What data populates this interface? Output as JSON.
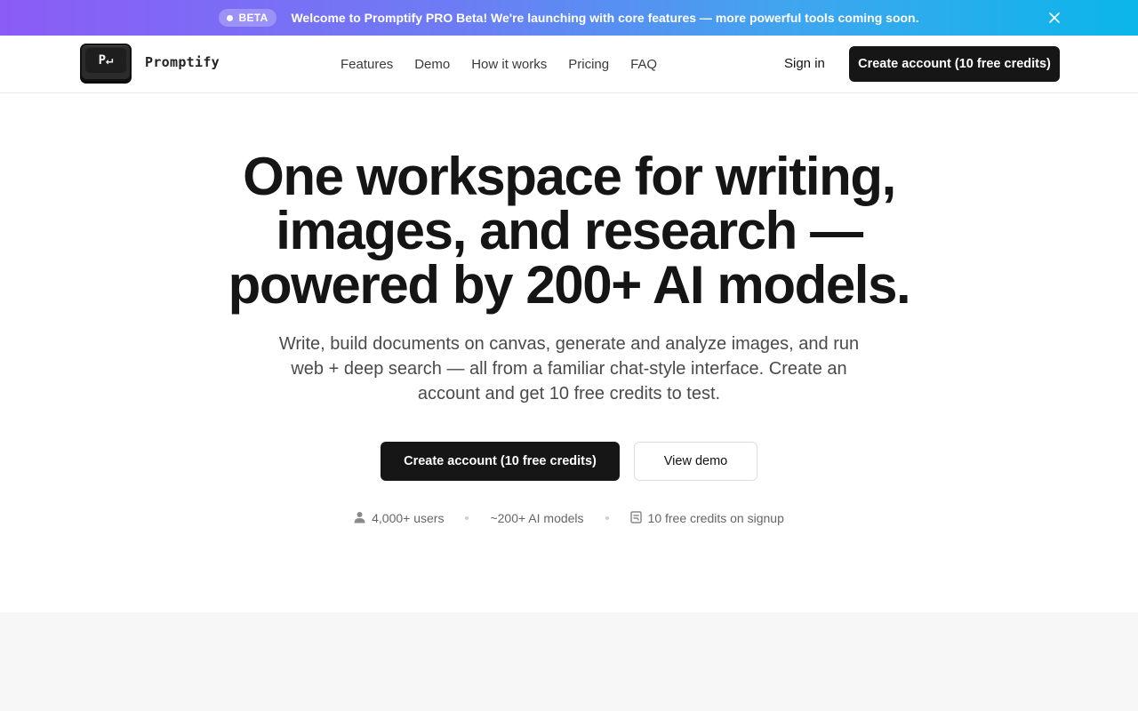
{
  "banner": {
    "badge": "BETA",
    "message": "Welcome to Promptify PRO Beta! We're launching with core features — more powerful tools coming soon.",
    "close_icon": "close-icon",
    "gradient_colors": [
      "#8b5cf6",
      "#0ab6ea"
    ]
  },
  "header": {
    "logo_key": "P↵",
    "brand_name": "Promptify",
    "nav": [
      {
        "label": "Features"
      },
      {
        "label": "Demo"
      },
      {
        "label": "How it works"
      },
      {
        "label": "Pricing"
      },
      {
        "label": "FAQ"
      }
    ],
    "signin_label": "Sign in",
    "cta_label": "Create account (10 free credits)"
  },
  "hero": {
    "title_line1": "One workspace for writing,",
    "title_line2": "images, and research —",
    "title_line3": "powered by 200+ AI models.",
    "subtitle": "Write, build documents on canvas, generate and analyze images, and run web + deep search — all from a familiar chat-style interface. Create an account and get 10 free credits to test.",
    "primary_cta": "Create account (10 free credits)",
    "secondary_cta": "View demo"
  },
  "stats": [
    {
      "icon": "user-icon",
      "label": "4,000+ users"
    },
    {
      "icon": "",
      "label": "~200+ AI models"
    },
    {
      "icon": "credit-badge-icon",
      "label": "10 free credits on signup"
    }
  ],
  "colors": {
    "primary_button": "#161616",
    "page_background": "#ffffff",
    "section_band": "#f7f7f7"
  }
}
